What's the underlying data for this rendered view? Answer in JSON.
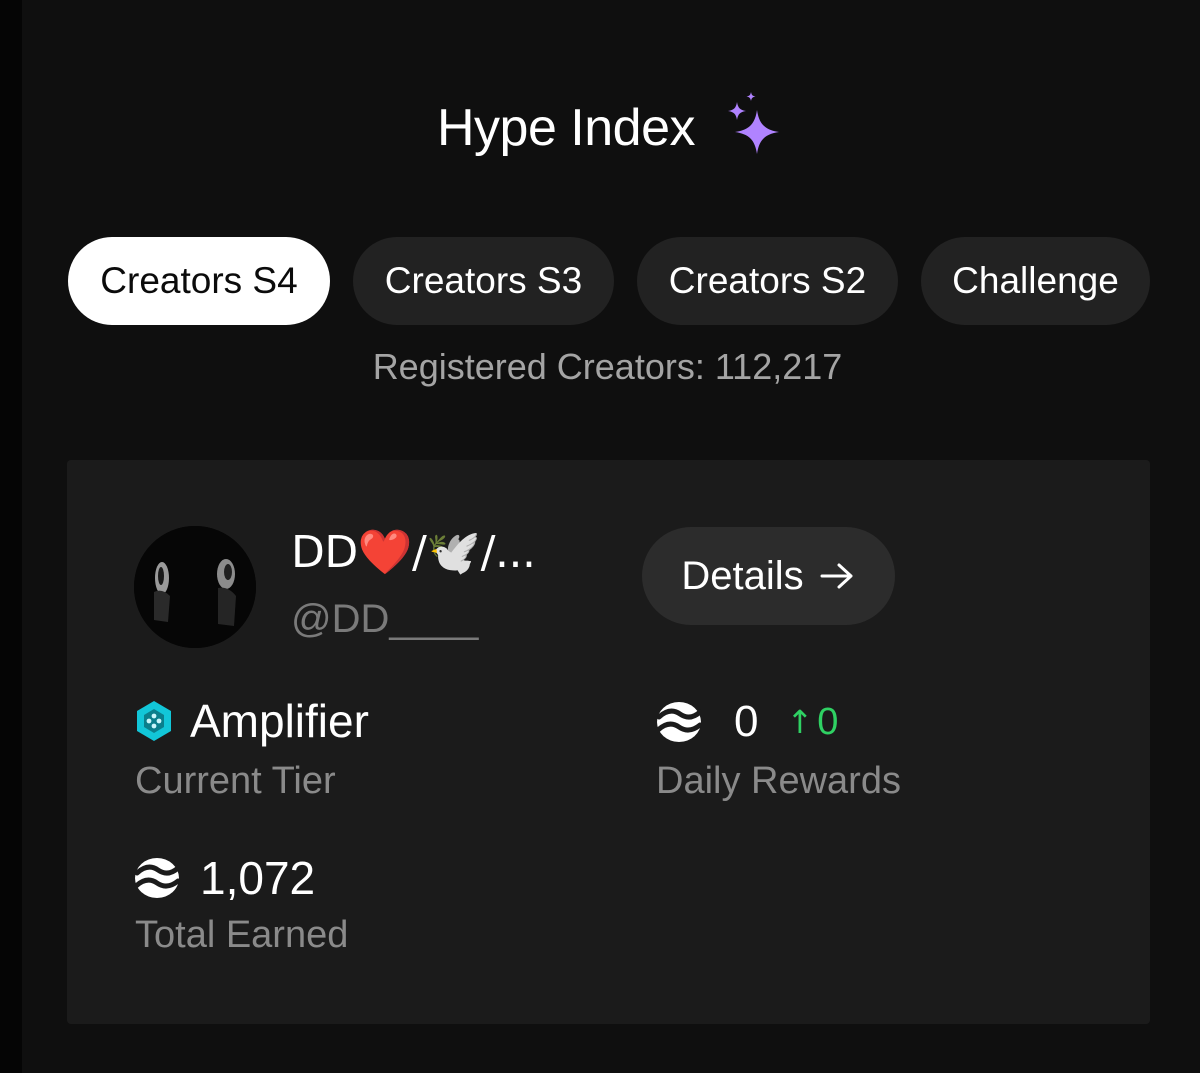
{
  "header": {
    "title": "Hype Index",
    "title_icon": "sparkles-icon"
  },
  "tabs": [
    {
      "label": "Creators S4",
      "active": true
    },
    {
      "label": "Creators S3",
      "active": false
    },
    {
      "label": "Creators S2",
      "active": false
    },
    {
      "label": "Challenge",
      "active": false
    }
  ],
  "registered_creators": "Registered Creators: 112,217",
  "profile": {
    "display_name": "DD❤️/🕊️/...",
    "handle": "@DD____",
    "avatar_icon": "avatar",
    "details_label": "Details",
    "details_icon": "arrow-right-icon"
  },
  "stats": {
    "tier": {
      "value": "Amplifier",
      "label": "Current Tier",
      "icon": "hexagon-tier-icon"
    },
    "daily_rewards": {
      "value": "0",
      "delta_arrow": "↑",
      "delta": "0",
      "label": "Daily Rewards",
      "icon": "token-icon"
    },
    "total_earned": {
      "value": "1,072",
      "label": "Total Earned",
      "icon": "token-icon"
    }
  },
  "colors": {
    "background": "#0f0f0f",
    "card": "#1b1b1b",
    "pill": "#222222",
    "active_pill": "#ffffff",
    "accent_purple": "#b083ff",
    "tier_cyan": "#12c6d8",
    "positive_green": "#2fd163",
    "muted_text": "#8a8a8a"
  }
}
